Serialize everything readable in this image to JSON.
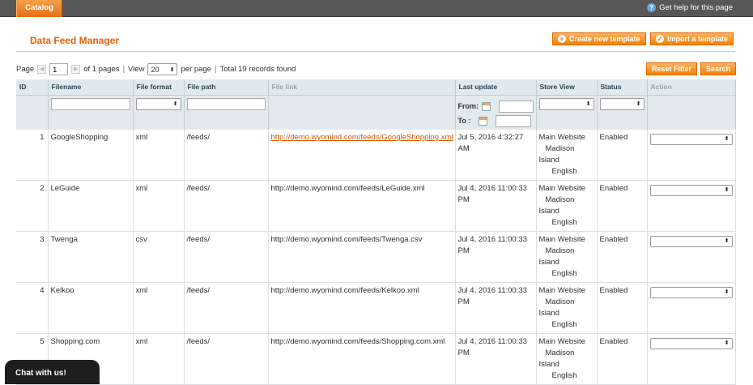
{
  "topbar": {
    "tab_label": "Catalog",
    "help_label": "Get help for this page"
  },
  "page": {
    "title": "Data Feed Manager"
  },
  "buttons": {
    "create_template": "Create new template",
    "import_template": "Import a template",
    "reset_filter": "Reset Filter",
    "search": "Search"
  },
  "pager": {
    "page_label": "Page",
    "page_value": "1",
    "of_pages": "of 1 pages",
    "view_label": "View",
    "view_value": "20",
    "per_page": "per page",
    "total": "Total 19 records found"
  },
  "columns": [
    "ID",
    "Filename",
    "File format",
    "File path",
    "File link",
    "Last update",
    "Store View",
    "Status",
    "Action"
  ],
  "filter": {
    "from_label": "From:",
    "to_label": "To :"
  },
  "rows": [
    {
      "id": "1",
      "filename": "GoogleShopping",
      "format": "xml",
      "path": "/feeds/",
      "link": "http://demo.wyomind.com/feeds/GoogleShopping.xml",
      "link_active": true,
      "update_line1": "Jul 5, 2016 4:32:27",
      "update_line2": "AM",
      "store": [
        "Main Website",
        "Madison",
        "Island",
        "English"
      ],
      "status": "Enabled"
    },
    {
      "id": "2",
      "filename": "LeGuide",
      "format": "xml",
      "path": "/feeds/",
      "link": "http://demo.wyomind.com/feeds/LeGuide.xml",
      "link_active": false,
      "update_line1": "Jul 4, 2016 11:00:33",
      "update_line2": "PM",
      "store": [
        "Main Website",
        "Madison",
        "Island",
        "English"
      ],
      "status": "Enabled"
    },
    {
      "id": "3",
      "filename": "Twenga",
      "format": "csv",
      "path": "/feeds/",
      "link": "http://demo.wyomind.com/feeds/Twenga.csv",
      "link_active": false,
      "update_line1": "Jul 4, 2016 11:00:33",
      "update_line2": "PM",
      "store": [
        "Main Website",
        "Madison",
        "Island",
        "English"
      ],
      "status": "Enabled"
    },
    {
      "id": "4",
      "filename": "Kelkoo",
      "format": "xml",
      "path": "/feeds/",
      "link": "http://demo.wyomind.com/feeds/Kelkoo.xml",
      "link_active": false,
      "update_line1": "Jul 4, 2016 11:00:33",
      "update_line2": "PM",
      "store": [
        "Main Website",
        "Madison",
        "Island",
        "English"
      ],
      "status": "Enabled"
    },
    {
      "id": "5",
      "filename": "Shopping.com",
      "format": "xml",
      "path": "/feeds/",
      "link": "http://demo.wyomind.com/feeds/Shopping.com.xml",
      "link_active": false,
      "update_line1": "Jul 4, 2016 11:00:33",
      "update_line2": "PM",
      "store": [
        "Main Website",
        "Madison",
        "Island",
        "English"
      ],
      "status": "Enabled"
    }
  ],
  "chat": {
    "label": "Chat with us!"
  }
}
